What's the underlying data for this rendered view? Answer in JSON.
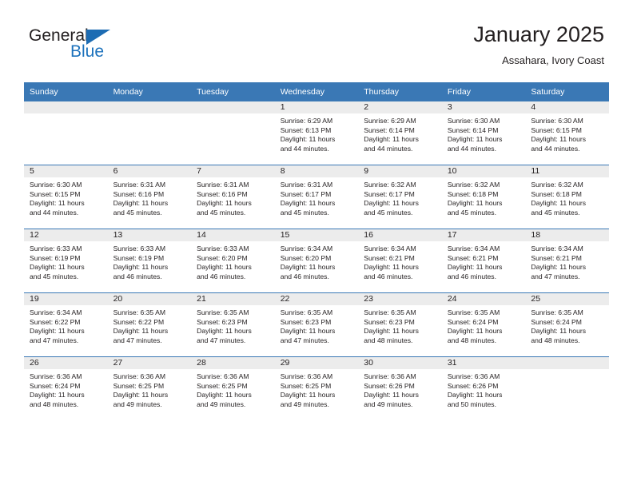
{
  "brand": {
    "name_part1": "General",
    "name_part2": "Blue"
  },
  "header": {
    "title": "January 2025",
    "location": "Assahara, Ivory Coast"
  },
  "colors": {
    "header_blue": "#3a78b5",
    "brand_blue": "#1d72bc",
    "date_strip_gray": "#ececec",
    "text": "#231f20"
  },
  "weekday_headers": [
    "Sunday",
    "Monday",
    "Tuesday",
    "Wednesday",
    "Thursday",
    "Friday",
    "Saturday"
  ],
  "labels": {
    "sunrise_prefix": "Sunrise:",
    "sunset_prefix": "Sunset:",
    "daylight_prefix": "Daylight:"
  },
  "weeks": [
    [
      {
        "day": "",
        "empty": true,
        "sunrise": "",
        "sunset": "",
        "daylight_line1": "",
        "daylight_line2": ""
      },
      {
        "day": "",
        "empty": true,
        "sunrise": "",
        "sunset": "",
        "daylight_line1": "",
        "daylight_line2": ""
      },
      {
        "day": "",
        "empty": true,
        "sunrise": "",
        "sunset": "",
        "daylight_line1": "",
        "daylight_line2": ""
      },
      {
        "day": "1",
        "sunrise": "Sunrise: 6:29 AM",
        "sunset": "Sunset: 6:13 PM",
        "daylight_line1": "Daylight: 11 hours",
        "daylight_line2": "and 44 minutes."
      },
      {
        "day": "2",
        "sunrise": "Sunrise: 6:29 AM",
        "sunset": "Sunset: 6:14 PM",
        "daylight_line1": "Daylight: 11 hours",
        "daylight_line2": "and 44 minutes."
      },
      {
        "day": "3",
        "sunrise": "Sunrise: 6:30 AM",
        "sunset": "Sunset: 6:14 PM",
        "daylight_line1": "Daylight: 11 hours",
        "daylight_line2": "and 44 minutes."
      },
      {
        "day": "4",
        "sunrise": "Sunrise: 6:30 AM",
        "sunset": "Sunset: 6:15 PM",
        "daylight_line1": "Daylight: 11 hours",
        "daylight_line2": "and 44 minutes."
      }
    ],
    [
      {
        "day": "5",
        "sunrise": "Sunrise: 6:30 AM",
        "sunset": "Sunset: 6:15 PM",
        "daylight_line1": "Daylight: 11 hours",
        "daylight_line2": "and 44 minutes."
      },
      {
        "day": "6",
        "sunrise": "Sunrise: 6:31 AM",
        "sunset": "Sunset: 6:16 PM",
        "daylight_line1": "Daylight: 11 hours",
        "daylight_line2": "and 45 minutes."
      },
      {
        "day": "7",
        "sunrise": "Sunrise: 6:31 AM",
        "sunset": "Sunset: 6:16 PM",
        "daylight_line1": "Daylight: 11 hours",
        "daylight_line2": "and 45 minutes."
      },
      {
        "day": "8",
        "sunrise": "Sunrise: 6:31 AM",
        "sunset": "Sunset: 6:17 PM",
        "daylight_line1": "Daylight: 11 hours",
        "daylight_line2": "and 45 minutes."
      },
      {
        "day": "9",
        "sunrise": "Sunrise: 6:32 AM",
        "sunset": "Sunset: 6:17 PM",
        "daylight_line1": "Daylight: 11 hours",
        "daylight_line2": "and 45 minutes."
      },
      {
        "day": "10",
        "sunrise": "Sunrise: 6:32 AM",
        "sunset": "Sunset: 6:18 PM",
        "daylight_line1": "Daylight: 11 hours",
        "daylight_line2": "and 45 minutes."
      },
      {
        "day": "11",
        "sunrise": "Sunrise: 6:32 AM",
        "sunset": "Sunset: 6:18 PM",
        "daylight_line1": "Daylight: 11 hours",
        "daylight_line2": "and 45 minutes."
      }
    ],
    [
      {
        "day": "12",
        "sunrise": "Sunrise: 6:33 AM",
        "sunset": "Sunset: 6:19 PM",
        "daylight_line1": "Daylight: 11 hours",
        "daylight_line2": "and 45 minutes."
      },
      {
        "day": "13",
        "sunrise": "Sunrise: 6:33 AM",
        "sunset": "Sunset: 6:19 PM",
        "daylight_line1": "Daylight: 11 hours",
        "daylight_line2": "and 46 minutes."
      },
      {
        "day": "14",
        "sunrise": "Sunrise: 6:33 AM",
        "sunset": "Sunset: 6:20 PM",
        "daylight_line1": "Daylight: 11 hours",
        "daylight_line2": "and 46 minutes."
      },
      {
        "day": "15",
        "sunrise": "Sunrise: 6:34 AM",
        "sunset": "Sunset: 6:20 PM",
        "daylight_line1": "Daylight: 11 hours",
        "daylight_line2": "and 46 minutes."
      },
      {
        "day": "16",
        "sunrise": "Sunrise: 6:34 AM",
        "sunset": "Sunset: 6:21 PM",
        "daylight_line1": "Daylight: 11 hours",
        "daylight_line2": "and 46 minutes."
      },
      {
        "day": "17",
        "sunrise": "Sunrise: 6:34 AM",
        "sunset": "Sunset: 6:21 PM",
        "daylight_line1": "Daylight: 11 hours",
        "daylight_line2": "and 46 minutes."
      },
      {
        "day": "18",
        "sunrise": "Sunrise: 6:34 AM",
        "sunset": "Sunset: 6:21 PM",
        "daylight_line1": "Daylight: 11 hours",
        "daylight_line2": "and 47 minutes."
      }
    ],
    [
      {
        "day": "19",
        "sunrise": "Sunrise: 6:34 AM",
        "sunset": "Sunset: 6:22 PM",
        "daylight_line1": "Daylight: 11 hours",
        "daylight_line2": "and 47 minutes."
      },
      {
        "day": "20",
        "sunrise": "Sunrise: 6:35 AM",
        "sunset": "Sunset: 6:22 PM",
        "daylight_line1": "Daylight: 11 hours",
        "daylight_line2": "and 47 minutes."
      },
      {
        "day": "21",
        "sunrise": "Sunrise: 6:35 AM",
        "sunset": "Sunset: 6:23 PM",
        "daylight_line1": "Daylight: 11 hours",
        "daylight_line2": "and 47 minutes."
      },
      {
        "day": "22",
        "sunrise": "Sunrise: 6:35 AM",
        "sunset": "Sunset: 6:23 PM",
        "daylight_line1": "Daylight: 11 hours",
        "daylight_line2": "and 47 minutes."
      },
      {
        "day": "23",
        "sunrise": "Sunrise: 6:35 AM",
        "sunset": "Sunset: 6:23 PM",
        "daylight_line1": "Daylight: 11 hours",
        "daylight_line2": "and 48 minutes."
      },
      {
        "day": "24",
        "sunrise": "Sunrise: 6:35 AM",
        "sunset": "Sunset: 6:24 PM",
        "daylight_line1": "Daylight: 11 hours",
        "daylight_line2": "and 48 minutes."
      },
      {
        "day": "25",
        "sunrise": "Sunrise: 6:35 AM",
        "sunset": "Sunset: 6:24 PM",
        "daylight_line1": "Daylight: 11 hours",
        "daylight_line2": "and 48 minutes."
      }
    ],
    [
      {
        "day": "26",
        "sunrise": "Sunrise: 6:36 AM",
        "sunset": "Sunset: 6:24 PM",
        "daylight_line1": "Daylight: 11 hours",
        "daylight_line2": "and 48 minutes."
      },
      {
        "day": "27",
        "sunrise": "Sunrise: 6:36 AM",
        "sunset": "Sunset: 6:25 PM",
        "daylight_line1": "Daylight: 11 hours",
        "daylight_line2": "and 49 minutes."
      },
      {
        "day": "28",
        "sunrise": "Sunrise: 6:36 AM",
        "sunset": "Sunset: 6:25 PM",
        "daylight_line1": "Daylight: 11 hours",
        "daylight_line2": "and 49 minutes."
      },
      {
        "day": "29",
        "sunrise": "Sunrise: 6:36 AM",
        "sunset": "Sunset: 6:25 PM",
        "daylight_line1": "Daylight: 11 hours",
        "daylight_line2": "and 49 minutes."
      },
      {
        "day": "30",
        "sunrise": "Sunrise: 6:36 AM",
        "sunset": "Sunset: 6:26 PM",
        "daylight_line1": "Daylight: 11 hours",
        "daylight_line2": "and 49 minutes."
      },
      {
        "day": "31",
        "sunrise": "Sunrise: 6:36 AM",
        "sunset": "Sunset: 6:26 PM",
        "daylight_line1": "Daylight: 11 hours",
        "daylight_line2": "and 50 minutes."
      },
      {
        "day": "",
        "empty": true,
        "sunrise": "",
        "sunset": "",
        "daylight_line1": "",
        "daylight_line2": ""
      }
    ]
  ]
}
